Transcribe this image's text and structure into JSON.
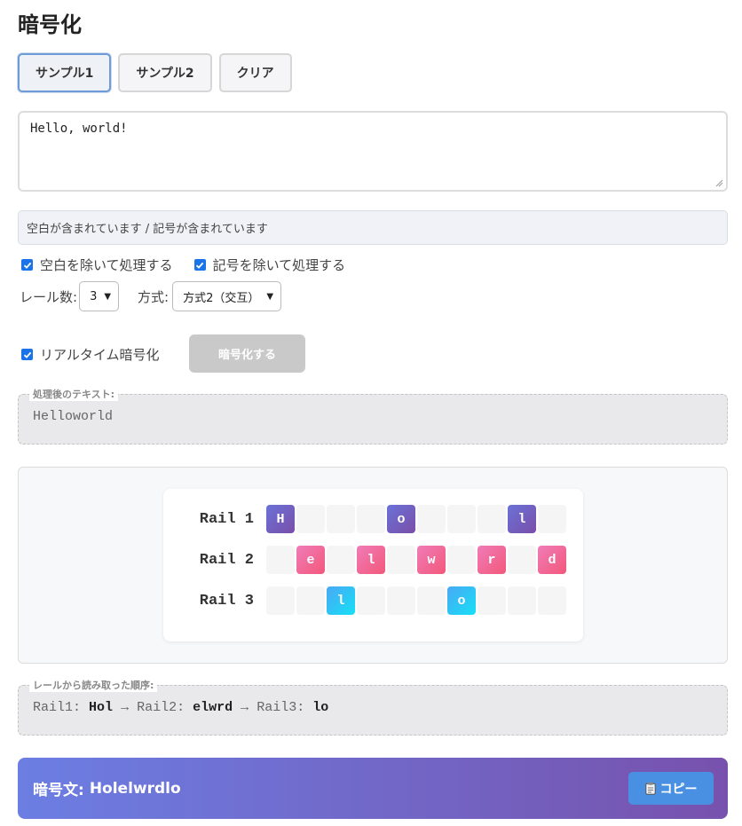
{
  "page": {
    "title": "暗号化"
  },
  "buttons": {
    "sample1": "サンプル1",
    "sample2": "サンプル2",
    "clear": "クリア"
  },
  "input": {
    "value": "Hello, world!"
  },
  "notice": "空白が含まれています / 記号が含まれています",
  "options": {
    "remove_spaces": {
      "label": "空白を除いて処理する",
      "checked": true
    },
    "remove_symbols": {
      "label": "記号を除いて処理する",
      "checked": true
    }
  },
  "rails": {
    "label": "レール数:",
    "value": "3"
  },
  "method": {
    "label": "方式:",
    "value": "方式2（交互）"
  },
  "realtime": {
    "label": "リアルタイム暗号化",
    "checked": true
  },
  "encrypt_button": "暗号化する",
  "processed": {
    "legend": "処理後のテキスト:",
    "text": "Helloworld"
  },
  "rail_grid": {
    "columns": 10,
    "rows": [
      {
        "label": "Rail 1",
        "cells": [
          "H",
          "",
          "",
          "",
          "o",
          "",
          "",
          "",
          "l",
          ""
        ]
      },
      {
        "label": "Rail 2",
        "cells": [
          "",
          "e",
          "",
          "l",
          "",
          "w",
          "",
          "r",
          "",
          "d"
        ]
      },
      {
        "label": "Rail 3",
        "cells": [
          "",
          "",
          "l",
          "",
          "",
          "",
          "o",
          "",
          "",
          ""
        ]
      }
    ]
  },
  "read_order": {
    "legend": "レールから読み取った順序:",
    "parts": [
      {
        "rail": "Rail1:",
        "value": "Hol"
      },
      {
        "rail": "Rail2:",
        "value": "elwrd"
      },
      {
        "rail": "Rail3:",
        "value": "lo"
      }
    ],
    "arrow": "→"
  },
  "result": {
    "label": "暗号文:",
    "value": "Holelwrdlo"
  },
  "copy_button": {
    "icon": "clipboard-icon",
    "label": "コピー"
  },
  "colors": {
    "rail1": "#6a72d8",
    "rail2": "#f2587a",
    "rail3": "#16e0f5",
    "checkbox": "#1a73e8",
    "result_bar_start": "#6c7ee3",
    "result_bar_end": "#7752ad",
    "copy_button": "#4a90e2"
  }
}
